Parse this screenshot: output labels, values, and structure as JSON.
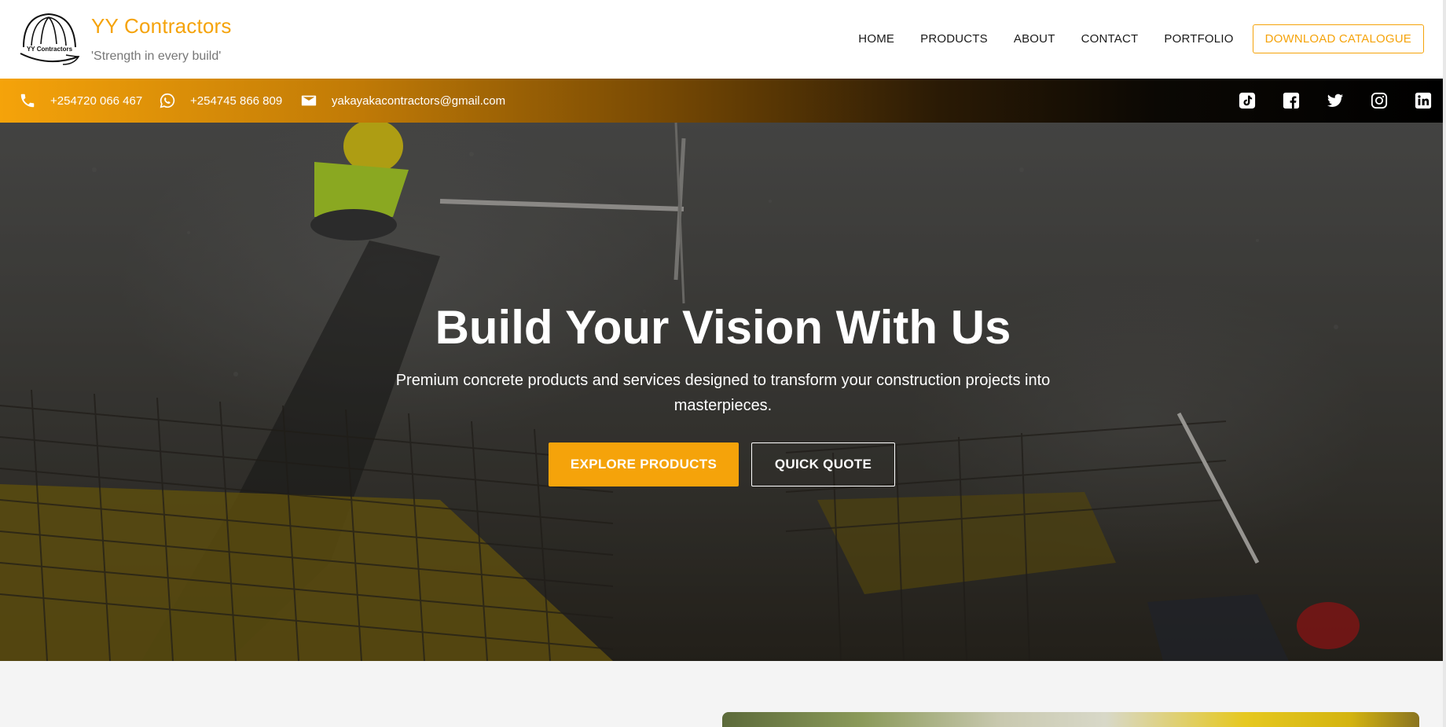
{
  "header": {
    "logo_text": "YY Contractors",
    "brand_name": "YY Contractors",
    "tagline": "'Strength in every build'",
    "nav": [
      "HOME",
      "PRODUCTS",
      "ABOUT",
      "CONTACT",
      "PORTFOLIO"
    ],
    "catalogue_label": "DOWNLOAD CATALOGUE"
  },
  "topbar": {
    "phone": "+254720 066 467",
    "whatsapp": "+254745 866 809",
    "email": "yakayakacontractors@gmail.com",
    "socials": [
      "tiktok-icon",
      "facebook-icon",
      "twitter-icon",
      "instagram-icon",
      "linkedin-icon"
    ]
  },
  "hero": {
    "title": "Build Your Vision With Us",
    "subtitle": "Premium concrete products and services designed to transform your construction projects into masterpieces.",
    "primary_cta": "EXPLORE PRODUCTS",
    "secondary_cta": "QUICK QUOTE"
  },
  "colors": {
    "accent": "#f5a30a",
    "text_dark": "#1a1a1a",
    "muted": "#777777"
  }
}
